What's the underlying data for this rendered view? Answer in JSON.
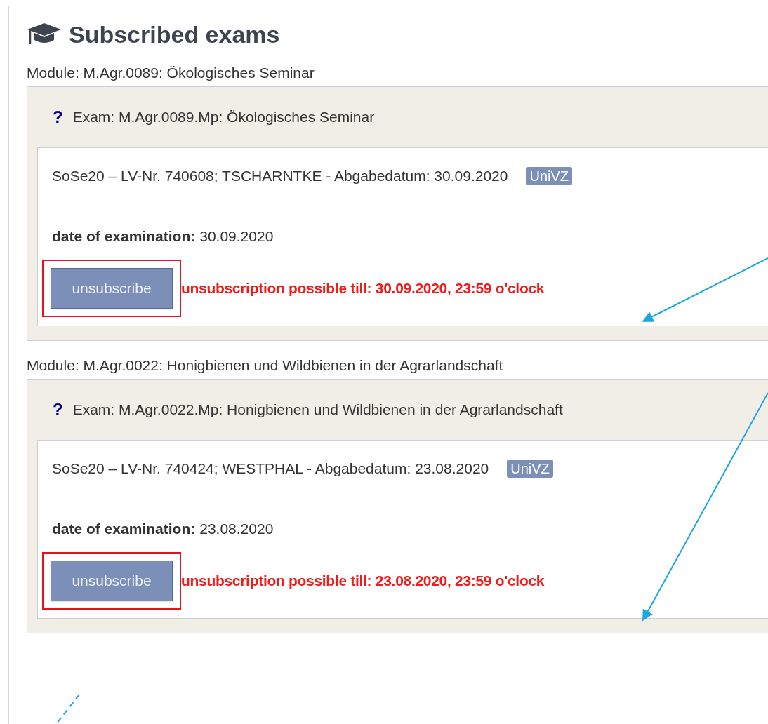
{
  "title": "Subscribed exams",
  "modules": [
    {
      "label": "Module: M.Agr.0089: Ökologisches Seminar",
      "exam_mark": "?",
      "exam": "Exam: M.Agr.0089.Mp: Ökologisches Seminar",
      "course": "SoSe20 – LV-Nr. 740608; TSCHARNTKE - Abgabedatum: 30.09.2020",
      "tag": "UniVZ",
      "date_label": "date of examination:",
      "date_value": "30.09.2020",
      "button": "unsubscribe",
      "highlighted": true,
      "deadline": "unsubscription possible till: 30.09.2020, 23:59 o'clock"
    },
    {
      "label": "Module: M.Agr.0022: Honigbienen und Wildbienen in der Agrarlandschaft",
      "exam_mark": "?",
      "exam": "Exam: M.Agr.0022.Mp: Honigbienen und Wildbienen in der Agrarlandschaft",
      "course": "SoSe20 – LV-Nr. 740424; WESTPHAL - Abgabedatum: 23.08.2020",
      "tag": "UniVZ",
      "date_label": "date of examination:",
      "date_value": "23.08.2020",
      "button": "unsubscribe",
      "highlighted": true,
      "deadline": "unsubscription possible till: 23.08.2020, 23:59 o'clock"
    }
  ]
}
